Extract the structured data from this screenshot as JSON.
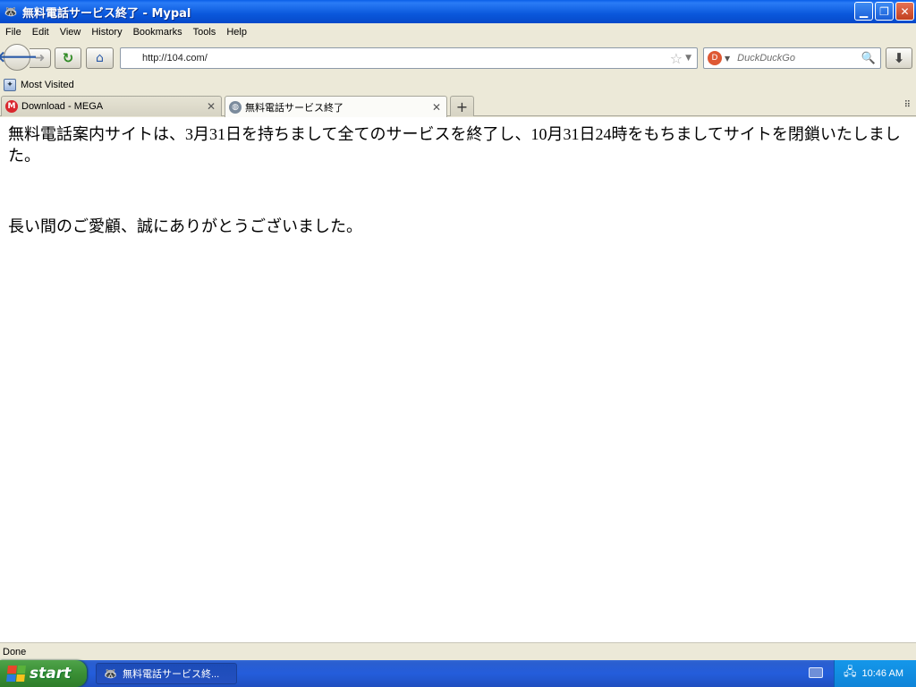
{
  "window": {
    "title": "無料電話サービス終了 - Mypal",
    "controls": [
      "minimize",
      "restore",
      "close"
    ]
  },
  "menu": {
    "items": [
      "File",
      "Edit",
      "View",
      "History",
      "Bookmarks",
      "Tools",
      "Help"
    ]
  },
  "navigation": {
    "url": "http://104.com/",
    "search_engine": "DuckDuckGo",
    "search_placeholder": "DuckDuckGo"
  },
  "bookmarks": {
    "items": [
      "Most Visited"
    ]
  },
  "tabs": [
    {
      "label": "Download - MEGA",
      "active": false
    },
    {
      "label": "無料電話サービス終了",
      "active": true
    }
  ],
  "page": {
    "paragraph1": "無料電話案内サイトは、3月31日を持ちまして全てのサービスを終了し、10月31日24時をもちましてサイトを閉鎖いたしました。",
    "paragraph2": "長い間のご愛顧、誠にありがとうございました。"
  },
  "status": {
    "text": "Done"
  },
  "taskbar": {
    "start_label": "start",
    "task_label": "無料電話サービス終...",
    "clock": "10:46 AM"
  }
}
